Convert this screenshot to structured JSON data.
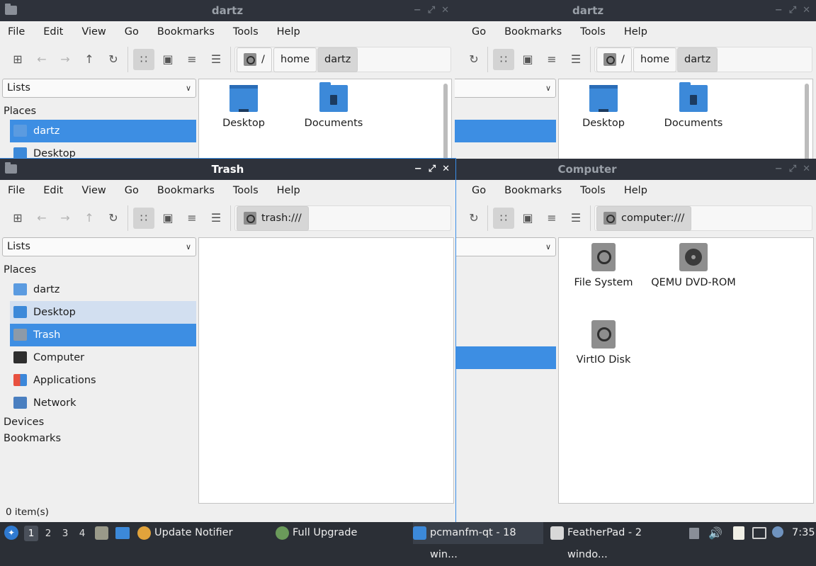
{
  "menu": [
    "File",
    "Edit",
    "View",
    "Go",
    "Bookmarks",
    "Tools",
    "Help"
  ],
  "window_top_left": {
    "title": "dartz",
    "breadcrumbs": [
      "/",
      "home",
      "dartz"
    ],
    "combo": "Lists",
    "places_header": "Places",
    "places": [
      "dartz",
      "Desktop"
    ],
    "items": [
      "Desktop",
      "Documents"
    ]
  },
  "window_top_right": {
    "title": "dartz",
    "menu": [
      "Go",
      "Bookmarks",
      "Tools",
      "Help"
    ],
    "breadcrumbs": [
      "/",
      "home",
      "dartz"
    ],
    "items": [
      "Desktop",
      "Documents"
    ]
  },
  "window_trash": {
    "title": "Trash",
    "path": "trash:///",
    "combo": "Lists",
    "places_header": "Places",
    "places": [
      "dartz",
      "Desktop",
      "Trash",
      "Computer",
      "Applications",
      "Network"
    ],
    "devices": "Devices",
    "bookmarks": "Bookmarks",
    "status": "0 item(s)"
  },
  "window_computer": {
    "title": "Computer",
    "menu": [
      "Go",
      "Bookmarks",
      "Tools",
      "Help"
    ],
    "path": "computer:///",
    "items": [
      "File System",
      "QEMU DVD-ROM",
      "VirtIO Disk"
    ]
  },
  "titlebar_buttons": [
    "−",
    "⤢",
    "✕"
  ],
  "taskbar": {
    "desktops": [
      "1",
      "2",
      "3",
      "4"
    ],
    "tasks": [
      "Update Notifier",
      "Full Upgrade",
      "pcmanfm-qt - 18 win...",
      "FeatherPad - 2 windo..."
    ],
    "clock": "7:35"
  },
  "colors": {
    "accent": "#3d8ee3",
    "titlebar": "#2e323b",
    "folder": "#3c89d9"
  }
}
